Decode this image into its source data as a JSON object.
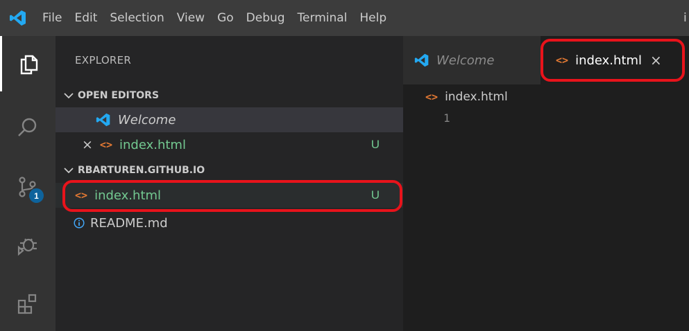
{
  "menubar": {
    "items": [
      "File",
      "Edit",
      "Selection",
      "View",
      "Go",
      "Debug",
      "Terminal",
      "Help"
    ],
    "truncated_title": "i"
  },
  "activity_bar": {
    "items": [
      "explorer",
      "search",
      "source-control",
      "debug",
      "extensions"
    ],
    "source_control_badge": "1"
  },
  "sidebar": {
    "title": "EXPLORER",
    "open_editors": {
      "header": "OPEN EDITORS",
      "items": [
        {
          "label": "Welcome",
          "icon": "vscode-icon"
        },
        {
          "label": "index.html",
          "icon": "html-icon",
          "status": "U",
          "close": "×"
        }
      ]
    },
    "workspace": {
      "header": "RBARTUREN.GITHUB.IO",
      "items": [
        {
          "label": "index.html",
          "icon": "html-icon",
          "status": "U"
        },
        {
          "label": "README.md",
          "icon": "info-icon"
        }
      ]
    }
  },
  "editor": {
    "tabs": [
      {
        "label": "Welcome",
        "active": false
      },
      {
        "label": "index.html",
        "active": true,
        "close": "×"
      }
    ],
    "breadcrumb": "index.html",
    "line_numbers": [
      "1"
    ]
  },
  "colors": {
    "accent_blue": "#0e639c",
    "git_untracked": "#73c991",
    "html_icon": "#e37933",
    "annotation_red": "#e8131b"
  }
}
